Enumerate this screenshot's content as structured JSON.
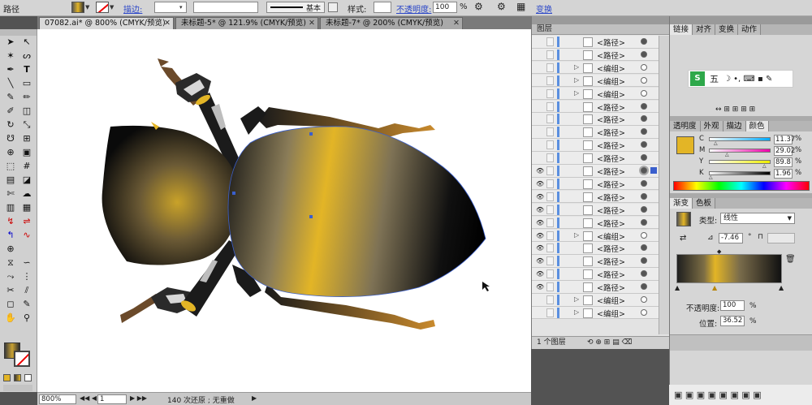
{
  "control_bar": {
    "object_type": "路径",
    "stroke_label": "描边:",
    "stroke_weight": "基本",
    "style_label": "样式:",
    "opacity_label": "不透明度:",
    "opacity_value": "100",
    "opacity_unit": "%",
    "transform_label": "变换"
  },
  "doc_tabs": [
    {
      "label": "07082.ai* @ 800% (CMYK/预览)",
      "active": true
    },
    {
      "label": "未标题-5* @ 121.9% (CMYK/预览)",
      "active": false
    },
    {
      "label": "未标题-7* @ 200% (CMYK/预览)",
      "active": false
    }
  ],
  "status": {
    "zoom": "800%",
    "page": "1",
    "history": "140 次还原 ; 无重做"
  },
  "layers": {
    "title": "图层",
    "footer": "1 个图层",
    "rows": [
      {
        "label": "<路径>",
        "kind": "path",
        "expand": false,
        "eye": false,
        "target": "filled"
      },
      {
        "label": "<路径>",
        "kind": "path",
        "expand": false,
        "eye": false,
        "target": "filled"
      },
      {
        "label": "<编组>",
        "kind": "group",
        "expand": true,
        "eye": false,
        "target": "empty"
      },
      {
        "label": "<编组>",
        "kind": "group",
        "expand": true,
        "eye": false,
        "target": "empty"
      },
      {
        "label": "<编组>",
        "kind": "group",
        "expand": true,
        "eye": false,
        "target": "empty"
      },
      {
        "label": "<路径>",
        "kind": "path",
        "expand": false,
        "eye": false,
        "target": "filled"
      },
      {
        "label": "<路径>",
        "kind": "path",
        "expand": false,
        "eye": false,
        "target": "filled"
      },
      {
        "label": "<路径>",
        "kind": "path",
        "expand": false,
        "eye": false,
        "target": "filled"
      },
      {
        "label": "<路径>",
        "kind": "path",
        "expand": false,
        "eye": false,
        "target": "filled"
      },
      {
        "label": "<路径>",
        "kind": "path",
        "expand": false,
        "eye": false,
        "target": "filled"
      },
      {
        "label": "<路径>",
        "kind": "path",
        "expand": false,
        "eye": true,
        "target": "selected"
      },
      {
        "label": "<路径>",
        "kind": "path",
        "expand": false,
        "eye": true,
        "target": "filled"
      },
      {
        "label": "<路径>",
        "kind": "path",
        "expand": false,
        "eye": true,
        "target": "filled"
      },
      {
        "label": "<路径>",
        "kind": "path",
        "expand": false,
        "eye": true,
        "target": "filled"
      },
      {
        "label": "<路径>",
        "kind": "path",
        "expand": false,
        "eye": true,
        "target": "filled"
      },
      {
        "label": "<编组>",
        "kind": "group",
        "expand": true,
        "eye": true,
        "target": "empty"
      },
      {
        "label": "<路径>",
        "kind": "path",
        "expand": false,
        "eye": true,
        "target": "filled"
      },
      {
        "label": "<路径>",
        "kind": "path",
        "expand": false,
        "eye": true,
        "target": "filled"
      },
      {
        "label": "<路径>",
        "kind": "path",
        "expand": false,
        "eye": true,
        "target": "filled"
      },
      {
        "label": "<路径>",
        "kind": "path",
        "expand": false,
        "eye": true,
        "target": "filled"
      },
      {
        "label": "<编组>",
        "kind": "group",
        "expand": true,
        "eye": false,
        "target": "empty"
      },
      {
        "label": "<编组>",
        "kind": "group",
        "expand": true,
        "eye": false,
        "target": "empty"
      }
    ]
  },
  "links_panel": {
    "tabs": [
      "链接",
      "对齐",
      "变换",
      "动作"
    ],
    "ime_label": "五"
  },
  "color_panel": {
    "tabs": [
      "透明度",
      "外观",
      "描边",
      "颜色"
    ],
    "channels": [
      {
        "name": "C",
        "value": "11.37",
        "pct": "%",
        "fill": 0.11
      },
      {
        "name": "M",
        "value": "29.02",
        "pct": "%",
        "fill": 0.29
      },
      {
        "name": "Y",
        "value": "89.8",
        "pct": "%",
        "fill": 0.9
      },
      {
        "name": "K",
        "value": "1.96",
        "pct": "%",
        "fill": 0.02
      }
    ],
    "fill_color": "#e3b526"
  },
  "gradient_panel": {
    "tabs": [
      "渐变",
      "色板"
    ],
    "type_label": "类型:",
    "type_value": "线性",
    "angle": "-7.46",
    "angle_unit": "°",
    "opacity_label": "不透明度:",
    "opacity_value": "100",
    "opacity_unit": "%",
    "location_label": "位置:",
    "location_value": "36.52",
    "location_unit": "%"
  },
  "colors": {
    "accent_gold": "#e3b526",
    "selection": "#3a5fcd"
  }
}
